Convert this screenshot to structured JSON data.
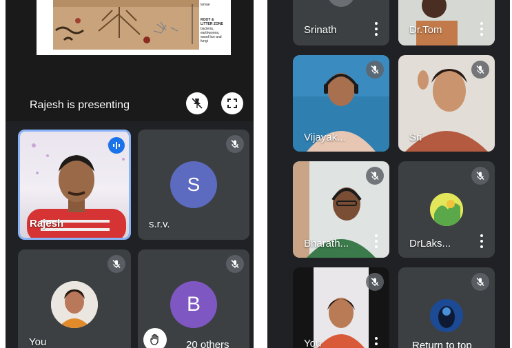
{
  "left_panel": {
    "presentation": {
      "caption": "Rajesh is presenting",
      "diagram_labels": [
        "larvae",
        "ROOT &",
        "LITTER ZONE",
        "bacteria,",
        "earthworms,",
        "wood lice and",
        "fungi"
      ]
    },
    "tiles": [
      {
        "name": "Rajesh"
      },
      {
        "name": "s.r.v.",
        "initial": "S"
      },
      {
        "name": "You"
      },
      {
        "name": "B",
        "initial": "B"
      }
    ],
    "others_label": "20 others"
  },
  "right_panel": {
    "tiles": [
      {
        "name": "Srinath"
      },
      {
        "name": "Dr.Tom"
      },
      {
        "name": "Vijayak..."
      },
      {
        "name": "Sri"
      },
      {
        "name": "Bharath..."
      },
      {
        "name": "DrLaks..."
      },
      {
        "name": "You"
      },
      {
        "name": "Return to top"
      }
    ]
  },
  "colors": {
    "app_background": "#202124",
    "tile": "#3c4043",
    "active_speaker_border": "#8ab4f8",
    "avatar_s": "#5c6bc0",
    "avatar_b": "#7e57c2"
  }
}
